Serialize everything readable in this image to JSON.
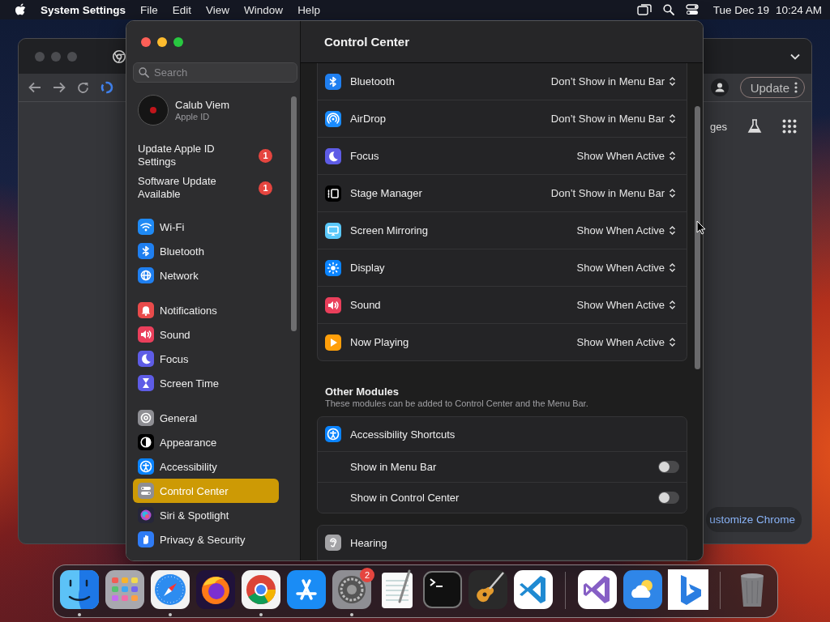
{
  "menu_bar": {
    "app_name": "System Settings",
    "menus": [
      "File",
      "Edit",
      "View",
      "Window",
      "Help"
    ],
    "date": "Tue Dec 19",
    "time": "10:24 AM"
  },
  "browser_window": {
    "update_button": "Update",
    "link_fragment": "ges",
    "customize_button": "ustomize Chrome"
  },
  "settings_window": {
    "title": "Control Center",
    "search": {
      "placeholder": "Search"
    },
    "account": {
      "name": "Calub Viem",
      "subtitle": "Apple ID"
    },
    "alerts": [
      {
        "label": "Update Apple ID Settings",
        "badge": "1"
      },
      {
        "label": "Software Update Available",
        "badge": "1"
      }
    ],
    "sidebar_groups": [
      {
        "items": [
          {
            "label": "Wi-Fi",
            "kind": "wifi",
            "selected": false
          },
          {
            "label": "Bluetooth",
            "kind": "bluetooth",
            "selected": false
          },
          {
            "label": "Network",
            "kind": "network",
            "selected": false
          }
        ]
      },
      {
        "items": [
          {
            "label": "Notifications",
            "kind": "notifications",
            "selected": false
          },
          {
            "label": "Sound",
            "kind": "sound",
            "selected": false
          },
          {
            "label": "Focus",
            "kind": "focus",
            "selected": false
          },
          {
            "label": "Screen Time",
            "kind": "screentime",
            "selected": false
          }
        ]
      },
      {
        "items": [
          {
            "label": "General",
            "kind": "general",
            "selected": false
          },
          {
            "label": "Appearance",
            "kind": "appearance",
            "selected": false
          },
          {
            "label": "Accessibility",
            "kind": "accessibility",
            "selected": false
          },
          {
            "label": "Control Center",
            "kind": "controlcenter",
            "selected": true
          },
          {
            "label": "Siri & Spotlight",
            "kind": "siri",
            "selected": false
          },
          {
            "label": "Privacy & Security",
            "kind": "privacy",
            "selected": false
          }
        ]
      }
    ],
    "modules": [
      {
        "label": "Bluetooth",
        "kind": "bluetooth",
        "value": "Don’t Show in Menu Bar"
      },
      {
        "label": "AirDrop",
        "kind": "airdrop",
        "value": "Don’t Show in Menu Bar"
      },
      {
        "label": "Focus",
        "kind": "focus",
        "value": "Show When Active"
      },
      {
        "label": "Stage Manager",
        "kind": "stagemanager",
        "value": "Don’t Show in Menu Bar"
      },
      {
        "label": "Screen Mirroring",
        "kind": "screenmirroring",
        "value": "Show When Active"
      },
      {
        "label": "Display",
        "kind": "display",
        "value": "Show When Active"
      },
      {
        "label": "Sound",
        "kind": "sound",
        "value": "Show When Active"
      },
      {
        "label": "Now Playing",
        "kind": "nowplaying",
        "value": "Show When Active"
      }
    ],
    "other_modules": {
      "title": "Other Modules",
      "subtitle": "These modules can be added to Control Center and the Menu Bar.",
      "cards": [
        {
          "title": "Accessibility Shortcuts",
          "kind": "accessibility",
          "options": [
            {
              "label": "Show in Menu Bar",
              "on": false
            },
            {
              "label": "Show in Control Center",
              "on": false
            }
          ]
        },
        {
          "title": "Hearing",
          "kind": "hearing"
        }
      ]
    }
  },
  "dock": {
    "sections": [
      {
        "apps": [
          {
            "kind": "finder",
            "running": true
          },
          {
            "kind": "launchpad",
            "running": false
          },
          {
            "kind": "safari",
            "running": true
          },
          {
            "kind": "firefox",
            "running": false
          },
          {
            "kind": "chrome",
            "running": true
          },
          {
            "kind": "appstore",
            "running": false
          },
          {
            "kind": "settings",
            "running": true,
            "badge": "2"
          },
          {
            "kind": "textedit",
            "running": false
          },
          {
            "kind": "terminal",
            "running": false
          },
          {
            "kind": "garageband",
            "running": false
          },
          {
            "kind": "vscode",
            "running": false
          }
        ]
      },
      {
        "apps": [
          {
            "kind": "visualstudio",
            "running": false
          },
          {
            "kind": "weather",
            "running": false
          },
          {
            "kind": "bing",
            "running": false
          }
        ]
      },
      {
        "apps": [
          {
            "kind": "trash",
            "running": false
          }
        ]
      }
    ]
  }
}
